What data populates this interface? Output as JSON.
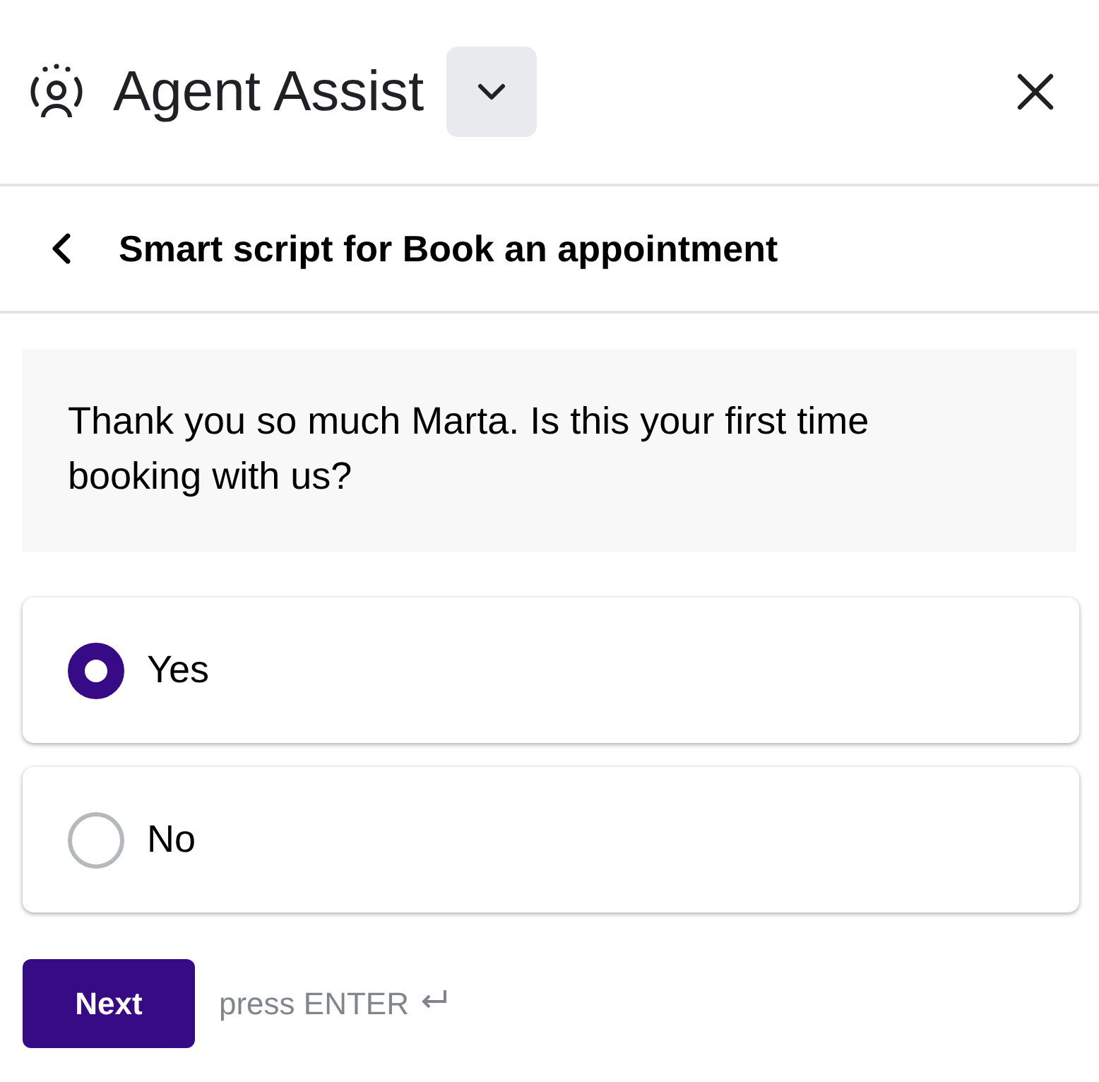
{
  "header": {
    "title": "Agent Assist"
  },
  "subheader": {
    "title": "Smart script for Book an appointment"
  },
  "prompt": {
    "text": "Thank you so much Marta. Is this your first time booking with us?"
  },
  "options": [
    {
      "label": "Yes",
      "selected": true
    },
    {
      "label": "No",
      "selected": false
    }
  ],
  "actions": {
    "button": "Next",
    "hint": "press ENTER"
  }
}
